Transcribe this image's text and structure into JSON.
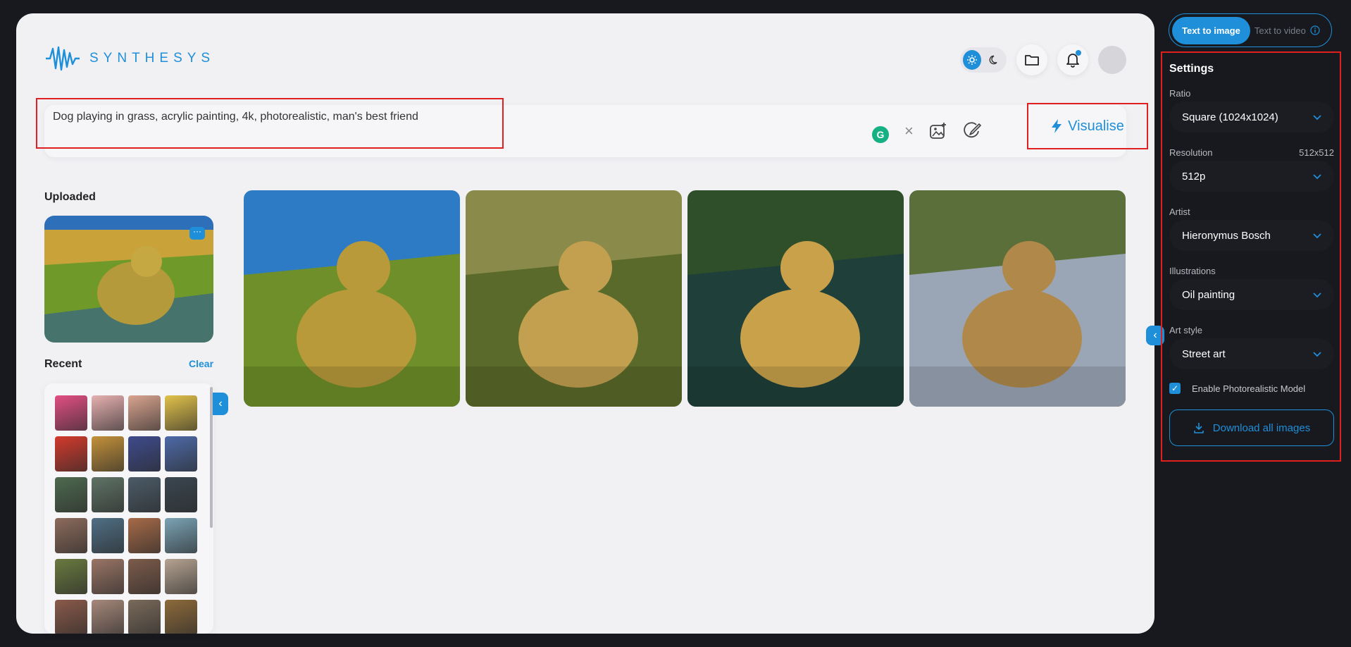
{
  "brand": {
    "name": "SYNTHESYS",
    "accent": "#1e8fd8"
  },
  "header": {
    "icons": [
      "sun-icon",
      "moon-icon",
      "folder-icon",
      "bell-icon",
      "avatar"
    ]
  },
  "prompt": {
    "text": "Dog playing in grass, acrylic painting, 4k, photorealistic, man's best friend",
    "grammarly_letter": "G",
    "clear_symbol": "×",
    "visualise_label": "Visualise"
  },
  "uploaded": {
    "title": "Uploaded",
    "more": "···"
  },
  "recent": {
    "title": "Recent",
    "clear_label": "Clear",
    "thumb_colors": [
      "#e24f83",
      "#e7b0b0",
      "#d9a48f",
      "#e2c24a",
      "#d33a2d",
      "#c3913a",
      "#3f4b8c",
      "#4d6aa8",
      "#4e6a4f",
      "#5f7366",
      "#4b5b68",
      "#3a4650",
      "#8c6b5c",
      "#4f6f85",
      "#a66a48",
      "#7aa3b5",
      "#6a7a3f",
      "#9a7565",
      "#7d5b4a",
      "#b6a392",
      "#8a5a4a",
      "#a6887a",
      "#7a6a5a",
      "#8d6a3a"
    ]
  },
  "gallery": {
    "images": [
      {
        "name": "generated-image-1",
        "palette": [
          "#2d7bc4",
          "#6f8f2a",
          "#b89a3b"
        ]
      },
      {
        "name": "generated-image-2",
        "palette": [
          "#8a8a4a",
          "#5a6a2a",
          "#c2a050"
        ]
      },
      {
        "name": "generated-image-3",
        "palette": [
          "#2f4f2a",
          "#1f3f3a",
          "#c8a14a"
        ]
      },
      {
        "name": "generated-image-4",
        "palette": [
          "#5a6f3a",
          "#9aa6b5",
          "#b0894a"
        ]
      }
    ]
  },
  "mode": {
    "active_label": "Text to image",
    "inactive_label": "Text to video"
  },
  "settings": {
    "title": "Settings",
    "ratio_label": "Ratio",
    "ratio_value": "Square (1024x1024)",
    "resolution_label": "Resolution",
    "resolution_hint": "512x512",
    "resolution_value": "512p",
    "artist_label": "Artist",
    "artist_value": "Hieronymus Bosch",
    "illustrations_label": "Illustrations",
    "illustrations_value": "Oil painting",
    "art_style_label": "Art style",
    "art_style_value": "Street art",
    "photoreal_label": "Enable Photorealistic Model",
    "photoreal_checked": true,
    "download_label": "Download all images"
  }
}
